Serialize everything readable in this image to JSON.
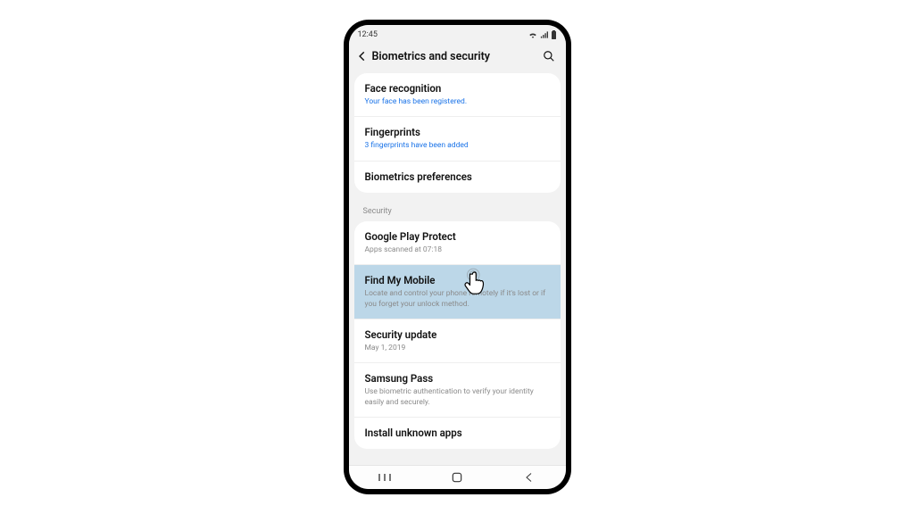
{
  "statusbar": {
    "time": "12:45"
  },
  "header": {
    "title": "Biometrics and security"
  },
  "group_biometrics": {
    "face": {
      "title": "Face recognition",
      "sub": "Your face has been registered."
    },
    "finger": {
      "title": "Fingerprints",
      "sub": "3 fingerprints have been added"
    },
    "prefs": {
      "title": "Biometrics preferences"
    }
  },
  "section_security_label": "Security",
  "group_security": {
    "play": {
      "title": "Google Play Protect",
      "sub": "Apps scanned at 07:18"
    },
    "findmy": {
      "title": "Find My Mobile",
      "sub": "Locate and control your phone remotely if it's lost or if you forget your unlock method."
    },
    "update": {
      "title": "Security update",
      "sub": "May 1, 2019"
    },
    "pass": {
      "title": "Samsung Pass",
      "sub": "Use biometric authentication to verify your identity easily and securely."
    },
    "unknown": {
      "title": "Install unknown apps"
    }
  }
}
